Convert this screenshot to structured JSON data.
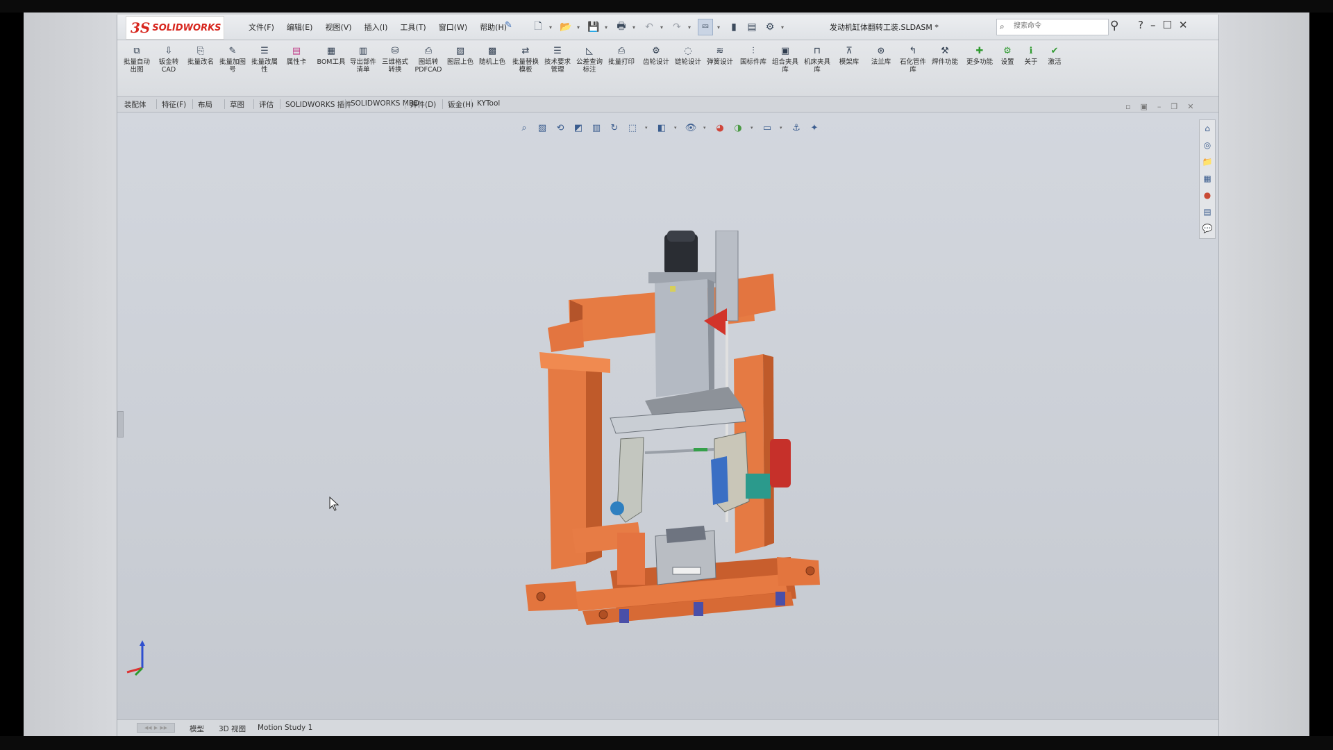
{
  "app": {
    "logo_ds": "3S",
    "logo_name": "SOLIDWORKS",
    "document_title": "发动机缸体翻转工装.SLDASM *",
    "search_placeholder": "搜索命令",
    "help": "?"
  },
  "menus": [
    "文件(F)",
    "编辑(E)",
    "视图(V)",
    "插入(I)",
    "工具(T)",
    "窗口(W)",
    "帮助(H)"
  ],
  "ribbon_tools": [
    {
      "label": "批量自动出图",
      "icon": "batch-drawing-icon",
      "color": "default"
    },
    {
      "label": "钣金转CAD",
      "icon": "sheetmetal-cad-icon",
      "color": "default"
    },
    {
      "label": "批量改名",
      "icon": "batch-rename-icon",
      "color": "default"
    },
    {
      "label": "批量加图号",
      "icon": "batch-number-icon",
      "color": "default"
    },
    {
      "label": "批量改属性",
      "icon": "batch-property-icon",
      "color": "default"
    },
    {
      "label": "属性卡",
      "icon": "property-card-icon",
      "color": "pink"
    },
    {
      "label": "BOM工具",
      "icon": "bom-icon",
      "color": "default"
    },
    {
      "label": "导出部件清单",
      "icon": "export-list-icon",
      "color": "default"
    },
    {
      "label": "三维格式转换",
      "icon": "3d-convert-icon",
      "color": "default"
    },
    {
      "label": "图纸转PDFCAD",
      "icon": "pdf-cad-icon",
      "color": "default"
    },
    {
      "label": "图层上色",
      "icon": "layer-color-icon",
      "color": "default"
    },
    {
      "label": "随机上色",
      "icon": "random-color-icon",
      "color": "default"
    },
    {
      "label": "批量替换模板",
      "icon": "replace-template-icon",
      "color": "default"
    },
    {
      "label": "技术要求管理",
      "icon": "tech-req-icon",
      "color": "default"
    },
    {
      "label": "公差查询标注",
      "icon": "tolerance-icon",
      "color": "default"
    },
    {
      "label": "批量打印",
      "icon": "batch-print-icon",
      "color": "default"
    },
    {
      "label": "齿轮设计",
      "icon": "gear-design-icon",
      "color": "default"
    },
    {
      "label": "链轮设计",
      "icon": "sprocket-icon",
      "color": "default"
    },
    {
      "label": "弹簧设计",
      "icon": "spring-icon",
      "color": "default"
    },
    {
      "label": "国标件库",
      "icon": "gb-library-icon",
      "color": "default"
    },
    {
      "label": "组合夹具库",
      "icon": "fixture-library-icon",
      "color": "default"
    },
    {
      "label": "机床夹具库",
      "icon": "machine-fixture-icon",
      "color": "default"
    },
    {
      "label": "模架库",
      "icon": "mold-base-icon",
      "color": "default"
    },
    {
      "label": "法兰库",
      "icon": "flange-icon",
      "color": "default"
    },
    {
      "label": "石化管件库",
      "icon": "pipe-fitting-icon",
      "color": "default"
    },
    {
      "label": "焊件功能",
      "icon": "weldment-icon",
      "color": "default"
    },
    {
      "label": "更多功能",
      "icon": "more-icon",
      "color": "green"
    },
    {
      "label": "设置",
      "icon": "settings-icon",
      "color": "green"
    },
    {
      "label": "关于",
      "icon": "info-icon",
      "color": "green"
    },
    {
      "label": "激活",
      "icon": "activate-icon",
      "color": "green"
    }
  ],
  "tabs": [
    "装配体",
    "特征(F)",
    "布局",
    "草图",
    "评估",
    "SOLIDWORKS 插件",
    "SOLIDWORKS MBD",
    "焊件(D)",
    "钣金(H)",
    "KYTool"
  ],
  "bottom_tabs": [
    "模型",
    "3D 视图",
    "Motion Study 1"
  ],
  "colors": {
    "frame_orange": "#e0703a",
    "frame_shadow": "#b9552a",
    "column_grey": "#aeb3bb",
    "accent_blue": "#2e7fc0",
    "motor_red": "#c6302a",
    "teal": "#2b9a8c"
  }
}
